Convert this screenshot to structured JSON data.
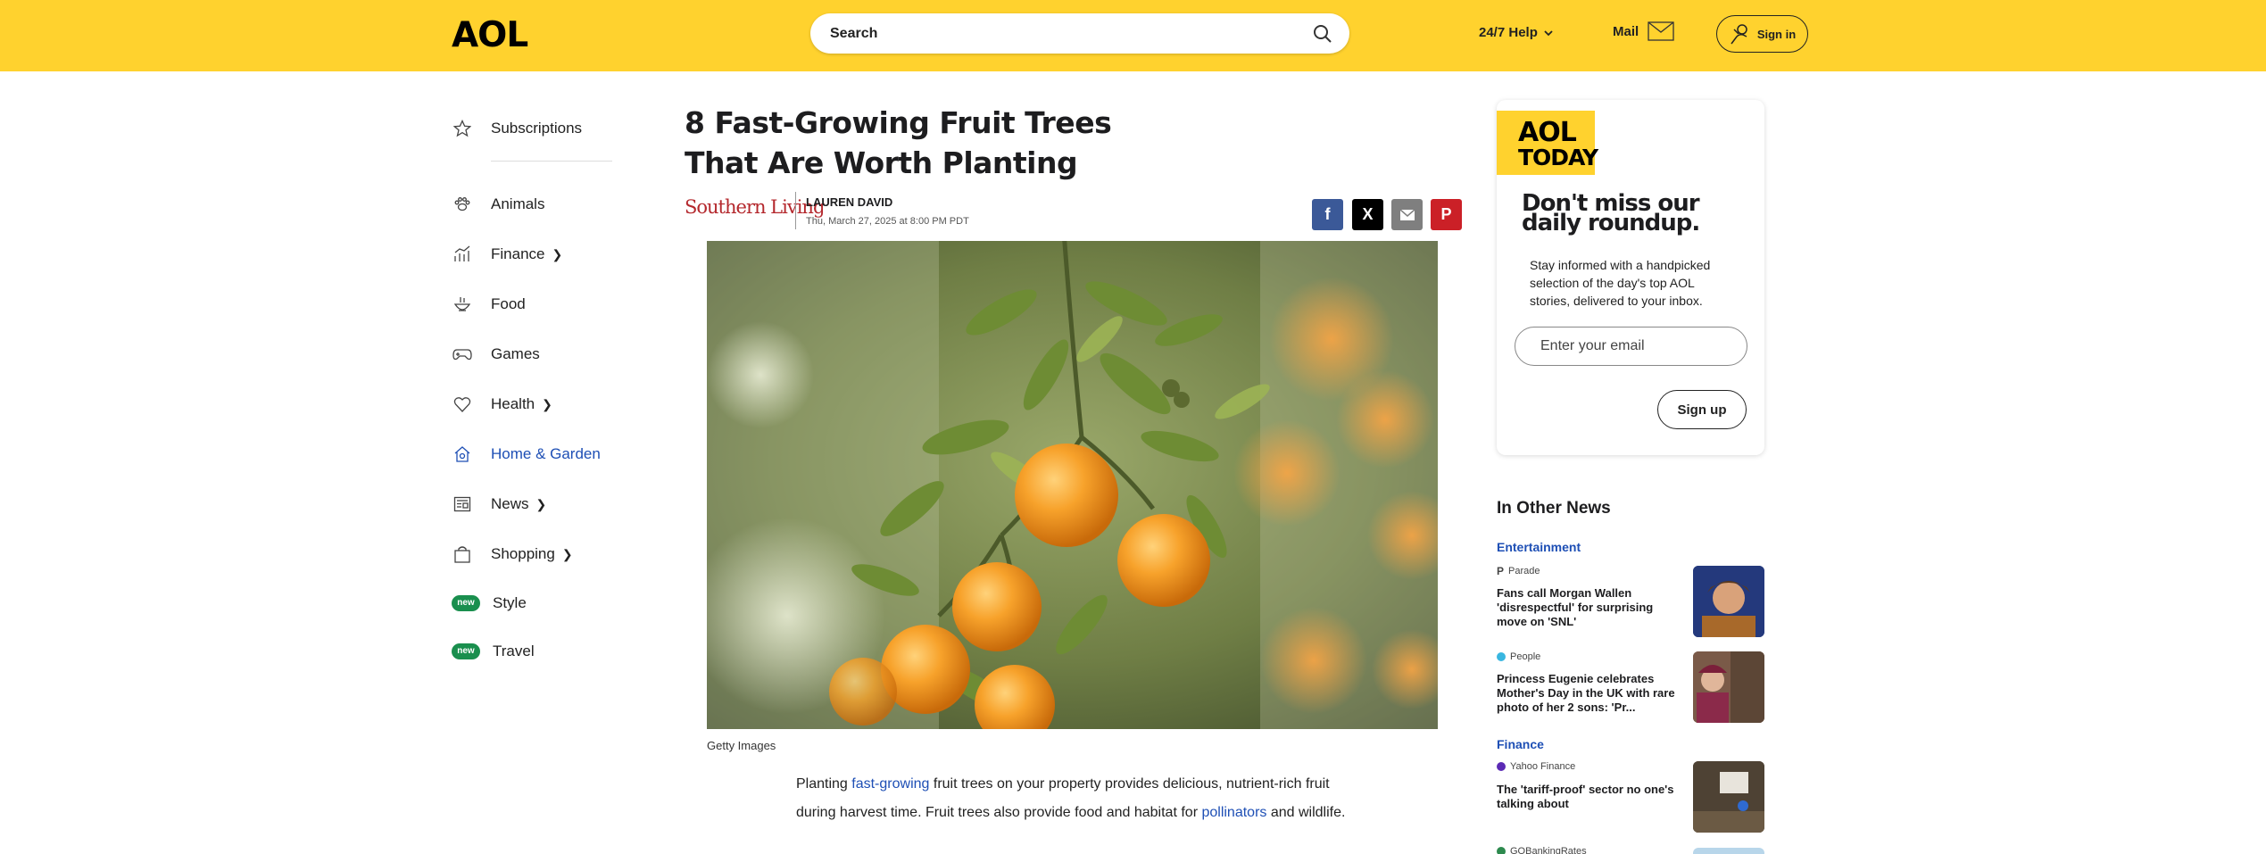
{
  "header": {
    "logo": "AOL",
    "search_placeholder": "Search",
    "help_label": "24/7 Help",
    "mail_label": "Mail",
    "signin_label": "Sign in"
  },
  "nav": {
    "subscriptions": "Subscriptions",
    "items": [
      {
        "label": "Animals",
        "icon": "paw-icon",
        "has_chevron": false
      },
      {
        "label": "Finance",
        "icon": "chart-icon",
        "has_chevron": true
      },
      {
        "label": "Food",
        "icon": "bowl-icon",
        "has_chevron": false
      },
      {
        "label": "Games",
        "icon": "gamepad-icon",
        "has_chevron": false
      },
      {
        "label": "Health",
        "icon": "heart-icon",
        "has_chevron": true
      },
      {
        "label": "Home & Garden",
        "icon": "home-garden-icon",
        "has_chevron": false,
        "active": true
      },
      {
        "label": "News",
        "icon": "newspaper-icon",
        "has_chevron": true
      },
      {
        "label": "Shopping",
        "icon": "bag-icon",
        "has_chevron": true
      }
    ],
    "new_badge": "new",
    "style_label": "Style",
    "travel_label": "Travel"
  },
  "article": {
    "headline": "8 Fast-Growing Fruit Trees That Are Worth Planting",
    "publisher": "Southern Living",
    "author": "LAUREN DAVID",
    "date": "Thu, March 27, 2025 at 8:00 PM PDT",
    "photo_credit": "Getty Images",
    "para_1": "Planting ",
    "link_1": "fast-growing",
    "para_2": " fruit trees on your property provides delicious, nutrient-rich fruit during harvest time. Fruit trees also provide food and habitat for ",
    "link_2": "pollinators",
    "para_3": " and wildlife."
  },
  "share": {
    "facebook": "f",
    "x": "X",
    "pinterest": "P"
  },
  "promo": {
    "logo_top": "AOL",
    "logo_bottom": "TODAY",
    "title": "Don't miss our daily roundup.",
    "text": "Stay informed with a handpicked selection of the day's top AOL stories, delivered to your inbox.",
    "email_placeholder": "Enter your email",
    "signup_label": "Sign up"
  },
  "other_news": {
    "title": "In Other News",
    "cat_1": "Entertainment",
    "cat_2": "Finance",
    "stories": [
      {
        "source": "Parade",
        "title": "Fans call Morgan Wallen 'disrespectful' for surprising move on 'SNL'"
      },
      {
        "source": "People",
        "title": "Princess Eugenie celebrates Mother's Day in the UK with rare photo of her 2 sons: 'Pr..."
      },
      {
        "source": "Yahoo Finance",
        "title": "The 'tariff-proof' sector no one's talking about"
      },
      {
        "source": "GOBankingRates",
        "title": ""
      }
    ]
  },
  "colors": {
    "header_yellow": "#ffd22e",
    "link_blue": "#1e4fb5",
    "new_badge_green": "#1a8f4e",
    "facebook": "#3b5998",
    "x": "#000000",
    "email": "#7f7f7f",
    "pinterest": "#cb2027"
  }
}
